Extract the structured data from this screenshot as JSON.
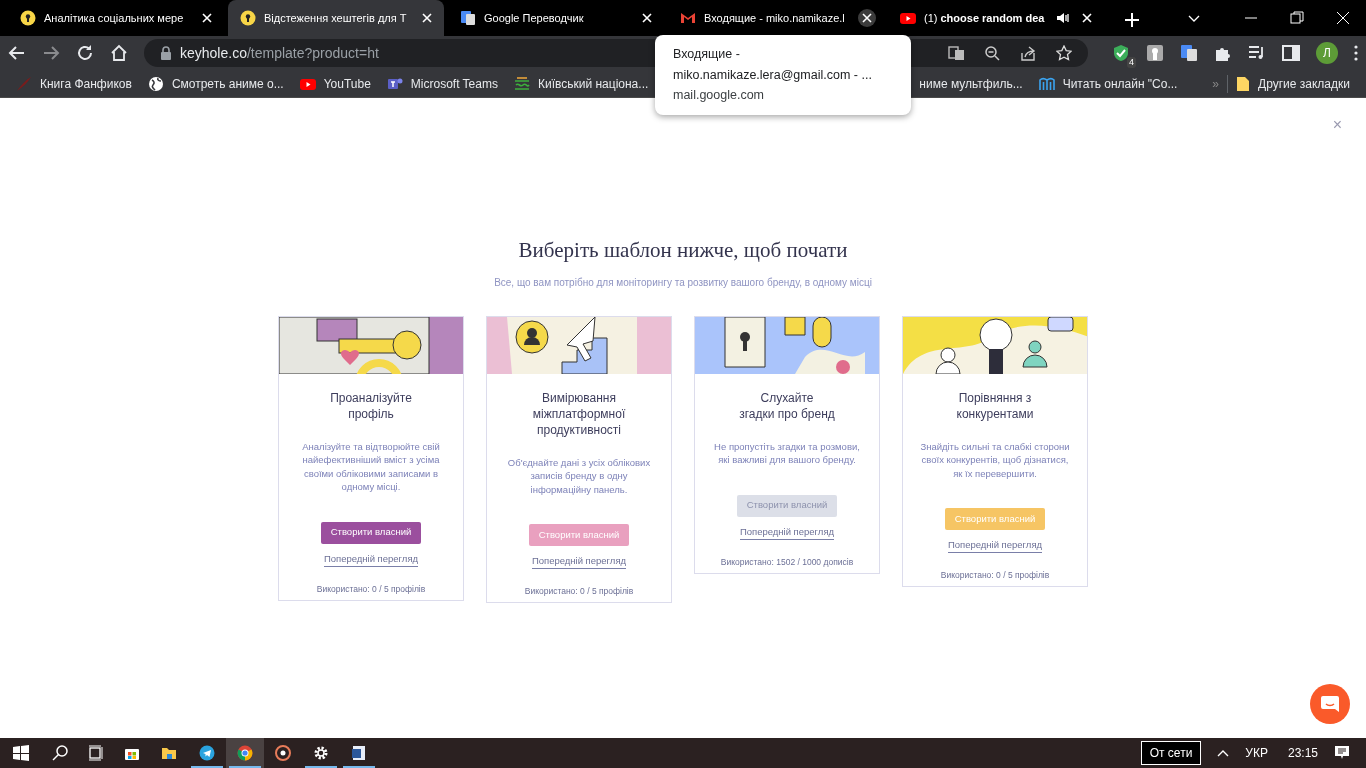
{
  "browser": {
    "tabs": [
      {
        "title": "Аналітика соціальних мере",
        "kind": "keyhole",
        "selected": false,
        "audio": false,
        "hovered_close": false
      },
      {
        "title": "Відстеження хештегів для T",
        "kind": "keyhole",
        "selected": true,
        "audio": false,
        "hovered_close": false
      },
      {
        "title": "Google Переводчик",
        "kind": "translate",
        "selected": false,
        "audio": false,
        "hovered_close": false
      },
      {
        "title": "Входящие - miko.namikaze.l",
        "kind": "mail",
        "selected": false,
        "audio": false,
        "hovered_close": true
      },
      {
        "title": "(1) **choose random dea**",
        "kind": "video",
        "selected": false,
        "audio": true,
        "hovered_close": false
      }
    ],
    "address": {
      "host": "keyhole.co",
      "path": "/template?product=ht"
    },
    "extension_badge": "4",
    "profile_initial": "Л",
    "bookmarks": [
      {
        "label": "Книга Фанфиков",
        "kind": "quill"
      },
      {
        "label": "Смотреть аниме о...",
        "kind": "globe"
      },
      {
        "label": "YouTube",
        "kind": "video"
      },
      {
        "label": "Microsoft Teams",
        "kind": "teams"
      },
      {
        "label": "Київський націона...",
        "kind": "university"
      },
      {
        "label": "ниме мультфиль...",
        "kind": "hidden"
      },
      {
        "label": "Читать онлайн \"Со...",
        "kind": "reader"
      }
    ],
    "more_bookmarks": "»",
    "other_bookmarks": "Другие закладки"
  },
  "tooltip": {
    "lines": [
      "Входящие -",
      "miko.namikaze.lera@gmail.com - ...",
      "mail.google.com"
    ]
  },
  "page": {
    "close": "×",
    "heading": "Виберіть шаблон нижче, щоб почати",
    "subtitle": "Все, що вам потрібно для моніторингу та розвитку вашого бренду, в одному місці",
    "cards": [
      {
        "kind": "profile",
        "title_lines": [
          "Проаналізуйте",
          "профіль"
        ],
        "description": "Аналізуйте та відтворюйте свій найефективніший вміст з усіма своїми обліковими записами в одному місці.",
        "button": "Створити власний",
        "color": "#9b4f9e",
        "disabled": false,
        "preview": "Попередній перегляд",
        "usage": "Використано: 0 / 5 профілів"
      },
      {
        "kind": "crossplatform",
        "title_lines": [
          "Вимірювання",
          "міжплатформної",
          "продуктивності"
        ],
        "description": "Об'єднайте дані з усіх облікових записів бренду в одну інформаційну панель.",
        "button": "Створити власний",
        "color": "#e9a0bf",
        "disabled": false,
        "preview": "Попередній перегляд",
        "usage": "Використано: 0 / 5 профілів"
      },
      {
        "kind": "mentions",
        "title_lines": [
          "Слухайте",
          "згадки про бренд"
        ],
        "description": "Не пропустіть згадки та розмови, які важливі для вашого бренду.",
        "button": "Створити власний",
        "color": "#dcdfe8",
        "disabled": true,
        "preview": "Попередній перегляд",
        "usage": "Використано: 1502 / 1000 дописів"
      },
      {
        "kind": "competitors",
        "title_lines": [
          "Порівняння з",
          "конкурентами"
        ],
        "description": "Знайдіть сильні та слабкі сторони своїх конкурентів, щоб дізнатися, як їх перевершити.",
        "button": "Створити власний",
        "color": "#f6c564",
        "disabled": false,
        "preview": "Попередній перегляд",
        "usage": "Використано: 0 / 5 профілів"
      }
    ]
  },
  "taskbar": {
    "apps": [
      {
        "kind": "search",
        "running": false,
        "selected": false
      },
      {
        "kind": "taskview",
        "running": false,
        "selected": false
      },
      {
        "kind": "store",
        "running": false,
        "selected": false
      },
      {
        "kind": "folder",
        "running": false,
        "selected": false
      },
      {
        "kind": "telegram",
        "running": true,
        "selected": false
      },
      {
        "kind": "chrome",
        "running": true,
        "selected": true
      },
      {
        "kind": "disc",
        "running": false,
        "selected": false
      },
      {
        "kind": "gear",
        "running": true,
        "selected": false
      },
      {
        "kind": "word",
        "running": true,
        "selected": false
      }
    ],
    "power_tooltip": "От сети",
    "language": "УКР",
    "time": "23:15"
  }
}
